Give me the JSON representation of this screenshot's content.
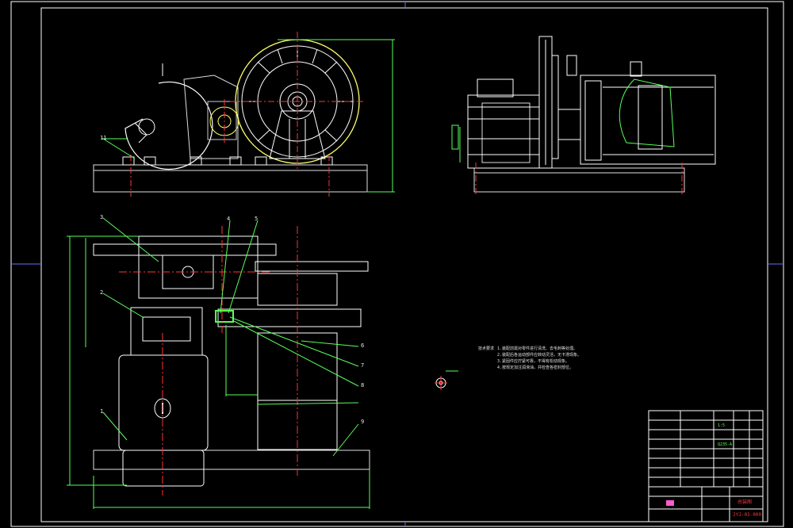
{
  "drawing": {
    "title_block": {
      "drawing_number": "JYJ-03-000",
      "scale_label": "1:5",
      "title_name": "总装图",
      "material_code": "Q235-A"
    },
    "callouts": {
      "top_left": "1",
      "plan_numbers": [
        "1",
        "2",
        "3",
        "4",
        "5",
        "6",
        "7",
        "8",
        "9"
      ]
    },
    "notes": {
      "heading": "技术要求",
      "lines": [
        "1.装配前需对零件进行清洗、去毛刺等处理。",
        "2.装配后各运动部件应转动灵活，无卡滞现象。",
        "3.紧固件应拧紧可靠，不得有松动现象。",
        "4.按规定加注润滑油，并检查各密封部位。"
      ]
    }
  }
}
